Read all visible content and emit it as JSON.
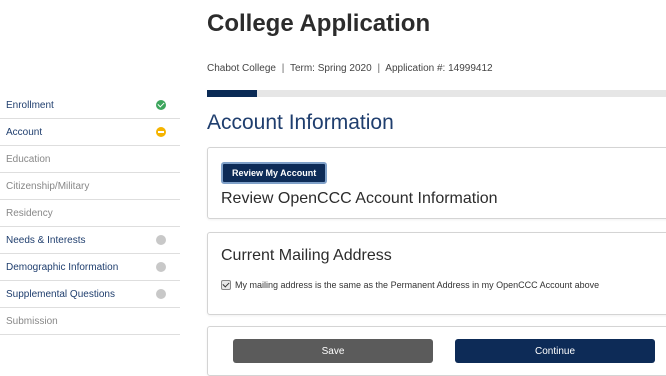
{
  "header": {
    "title": "College Application",
    "college": "Chabot College",
    "term": "Term: Spring 2020",
    "application": "Application #: 14999412",
    "separator": "|",
    "progress_fraction": 0.11
  },
  "section": {
    "title": "Account Information"
  },
  "sidebar": {
    "items": [
      {
        "label": "Enrollment",
        "status": "complete"
      },
      {
        "label": "Account",
        "status": "in-progress"
      },
      {
        "label": "Education",
        "status": "none"
      },
      {
        "label": "Citizenship/Military",
        "status": "none"
      },
      {
        "label": "Residency",
        "status": "none"
      },
      {
        "label": "Needs & Interests",
        "status": "incomplete"
      },
      {
        "label": "Demographic Information",
        "status": "incomplete"
      },
      {
        "label": "Supplemental Questions",
        "status": "incomplete"
      },
      {
        "label": "Submission",
        "status": "none"
      }
    ]
  },
  "review_card": {
    "button_label": "Review My Account",
    "heading": "Review OpenCCC Account Information"
  },
  "address_card": {
    "heading": "Current Mailing Address",
    "checkbox_label": "My mailing address is the same as the Permanent Address in my OpenCCC Account above",
    "checkbox_checked": true
  },
  "actions": {
    "save_label": "Save",
    "continue_label": "Continue"
  },
  "colors": {
    "primary": "#0d2b57",
    "complete": "#3ca55c",
    "in_progress": "#f5b400",
    "incomplete": "#c8c8c8"
  }
}
